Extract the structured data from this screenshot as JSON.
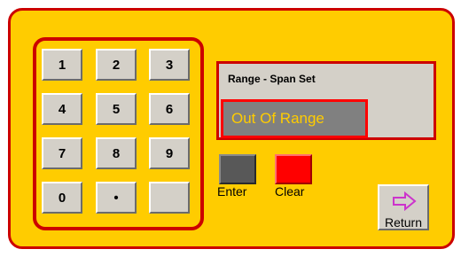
{
  "keypad": {
    "keys": [
      "1",
      "2",
      "3",
      "4",
      "5",
      "6",
      "7",
      "8",
      "9",
      "0",
      "•",
      ""
    ]
  },
  "display": {
    "title": "Range - Span Set",
    "status": "Out Of Range"
  },
  "controls": {
    "enter_label": "Enter",
    "clear_label": "Clear",
    "return_label": "Return"
  },
  "colors": {
    "panel": "#ffcc00",
    "border": "#cc0000",
    "status_text": "#ffcc00",
    "enter": "#585858",
    "clear": "#ff0000",
    "return_arrow": "#cc33cc"
  },
  "icons": {
    "return": "right-arrow-icon"
  }
}
